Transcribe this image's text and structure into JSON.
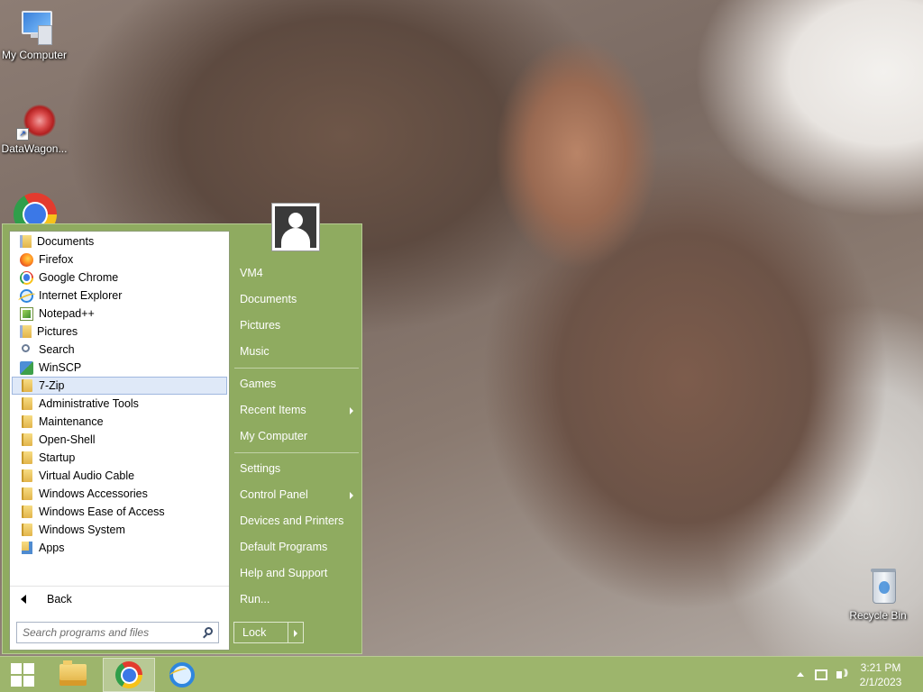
{
  "desktop": {
    "icons": [
      {
        "label": "My Computer",
        "icon": "my-computer-icon"
      },
      {
        "label": "DataWagon...",
        "icon": "datawagon-icon"
      },
      {
        "label": "Recycle Bin",
        "icon": "recycle-bin-icon"
      }
    ]
  },
  "start_menu": {
    "programs": [
      {
        "label": "Documents",
        "icon": "documents-folder-icon"
      },
      {
        "label": "Firefox",
        "icon": "firefox-icon"
      },
      {
        "label": "Google Chrome",
        "icon": "chrome-icon"
      },
      {
        "label": "Internet Explorer",
        "icon": "internet-explorer-icon"
      },
      {
        "label": "Notepad++",
        "icon": "notepadpp-icon"
      },
      {
        "label": "Pictures",
        "icon": "pictures-folder-icon"
      },
      {
        "label": "Search",
        "icon": "search-icon"
      },
      {
        "label": "WinSCP",
        "icon": "winscp-icon"
      },
      {
        "label": "7-Zip",
        "icon": "folder-icon",
        "selected": true
      },
      {
        "label": "Administrative Tools",
        "icon": "folder-icon"
      },
      {
        "label": "Maintenance",
        "icon": "folder-icon"
      },
      {
        "label": "Open-Shell",
        "icon": "folder-icon"
      },
      {
        "label": "Startup",
        "icon": "folder-icon"
      },
      {
        "label": "Virtual Audio Cable",
        "icon": "folder-icon"
      },
      {
        "label": "Windows Accessories",
        "icon": "folder-icon"
      },
      {
        "label": "Windows Ease of Access",
        "icon": "folder-icon"
      },
      {
        "label": "Windows System",
        "icon": "folder-icon"
      },
      {
        "label": "Apps",
        "icon": "apps-folder-icon"
      }
    ],
    "back_label": "Back",
    "search_placeholder": "Search programs and files",
    "right_items": [
      {
        "label": "VM4"
      },
      {
        "label": "Documents"
      },
      {
        "label": "Pictures"
      },
      {
        "label": "Music"
      },
      {
        "label": "Games"
      },
      {
        "label": "Recent Items",
        "submenu": true
      },
      {
        "label": "My Computer"
      },
      {
        "label": "Settings"
      },
      {
        "label": "Control Panel",
        "submenu": true
      },
      {
        "label": "Devices and Printers"
      },
      {
        "label": "Default Programs"
      },
      {
        "label": "Help and Support"
      },
      {
        "label": "Run..."
      }
    ],
    "lock_label": "Lock"
  },
  "taskbar": {
    "buttons": [
      "start-button",
      "file-explorer-button",
      "chrome-button",
      "internet-explorer-button"
    ],
    "active": "chrome-button",
    "clock_time": "3:21 PM",
    "clock_date": "2/1/2023"
  },
  "colors": {
    "menu_green": "#8fab60",
    "taskbar_green": "#9db56c",
    "selection": "#dfe9f8"
  }
}
